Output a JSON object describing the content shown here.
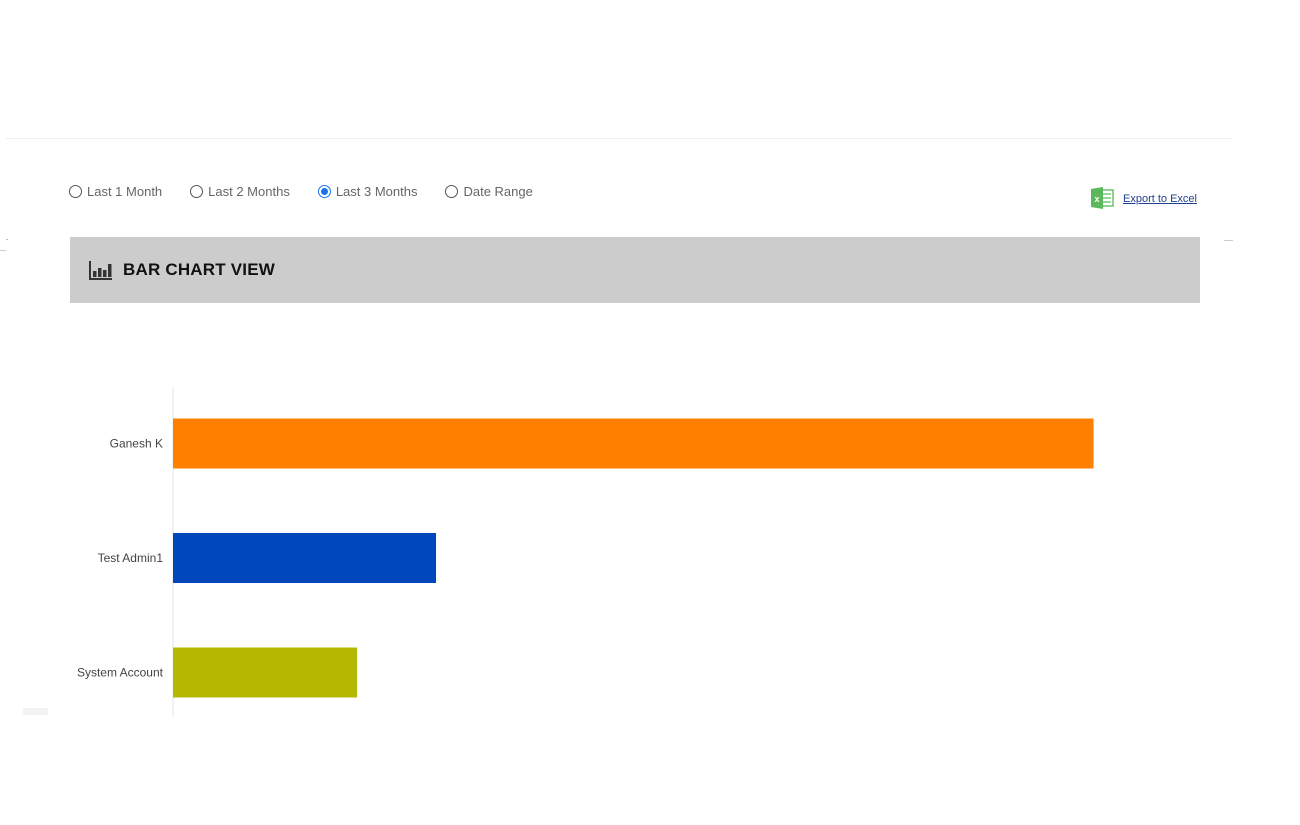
{
  "filters": {
    "options": [
      {
        "label": "Last 1 Month",
        "checked": false
      },
      {
        "label": "Last 2 Months",
        "checked": false
      },
      {
        "label": "Last 3 Months",
        "checked": true
      },
      {
        "label": "Date Range",
        "checked": false
      }
    ]
  },
  "export": {
    "label": "Export to Excel",
    "icon": "excel-icon",
    "icon_color": "#4caf50"
  },
  "chart_header": {
    "title": "BAR CHART VIEW",
    "icon": "bar-chart-icon"
  },
  "chart_data": {
    "type": "bar",
    "orientation": "horizontal",
    "categories": [
      "Ganesh K",
      "Test Admin1",
      "System Account"
    ],
    "values": [
      35,
      10,
      7
    ],
    "colors": [
      "#ff7f00",
      "#0047bb",
      "#b5b800"
    ],
    "xlim": [
      0,
      36.5
    ],
    "title": "",
    "xlabel": "",
    "ylabel": "",
    "grid": false,
    "legend": "none"
  }
}
